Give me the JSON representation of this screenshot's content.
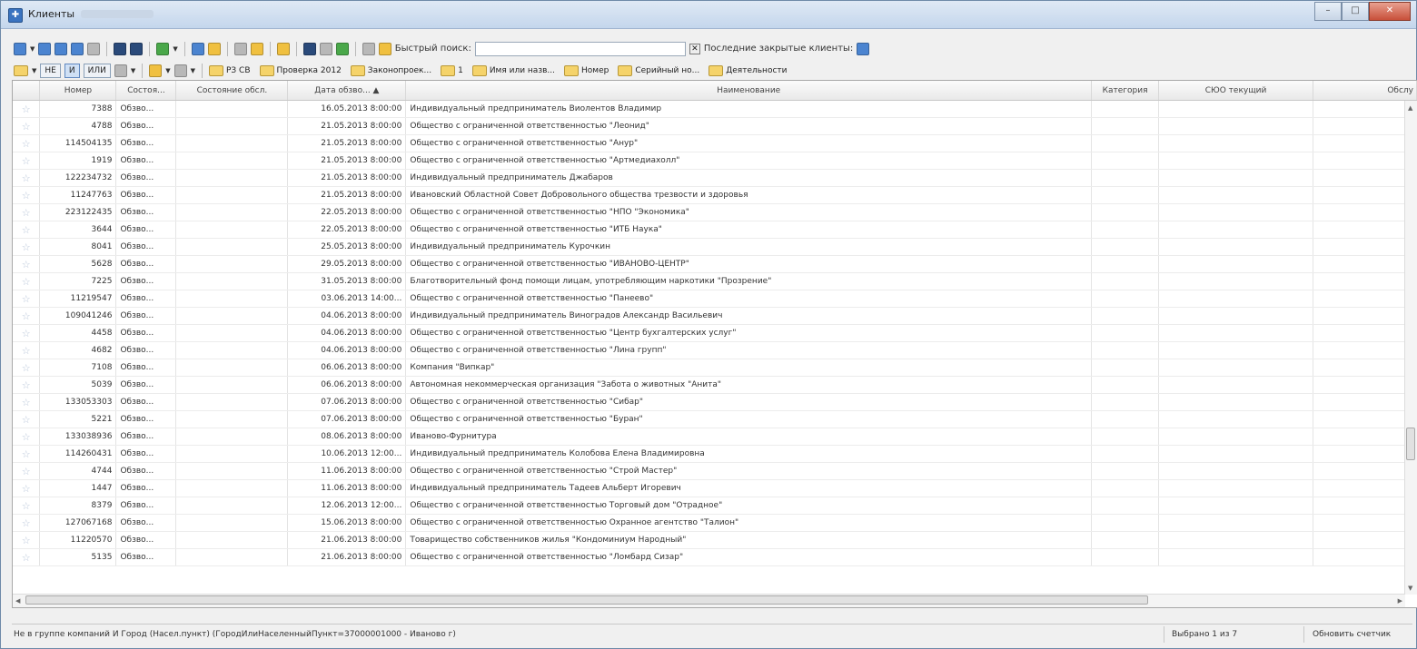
{
  "window": {
    "title": "Клиенты",
    "buttons": [
      "minimize",
      "maximize",
      "close"
    ]
  },
  "toolbar1": {
    "quick_search_label": "Быстрый поиск:",
    "quick_search_value": "",
    "recent_label": "Последние закрытые клиенты:"
  },
  "toolbar2": {
    "bool_not": "НЕ",
    "bool_and": "И",
    "bool_or": "ИЛИ",
    "filters": [
      "РЗ СВ",
      "Проверка 2012",
      "Законопроек...",
      "1",
      "Имя или назв...",
      "Номер",
      "Серийный но...",
      "Деятельности"
    ]
  },
  "grid": {
    "columns": [
      "",
      "Номер",
      "Состоя...",
      "Состояние обсл.",
      "Дата обзво... ▲",
      "Наименование",
      "Категория",
      "СЮО текущий",
      "Обслу"
    ],
    "rows": [
      [
        "7388",
        "Обзво...",
        "",
        "16.05.2013 8:00:00",
        "Индивидуальный предприниматель Виолентов Владимир"
      ],
      [
        "4788",
        "Обзво...",
        "",
        "21.05.2013 8:00:00",
        "Общество с ограниченной ответственностью \"Леонид\""
      ],
      [
        "114504135",
        "Обзво...",
        "",
        "21.05.2013 8:00:00",
        "Общество с ограниченной ответственностью \"Анур\""
      ],
      [
        "1919",
        "Обзво...",
        "",
        "21.05.2013 8:00:00",
        "Общество с ограниченной ответственностью \"Артмедиахолл\""
      ],
      [
        "122234732",
        "Обзво...",
        "",
        "21.05.2013 8:00:00",
        "Индивидуальный предприниматель Джабаров"
      ],
      [
        "11247763",
        "Обзво...",
        "",
        "21.05.2013 8:00:00",
        "Ивановский Областной Совет Добровольного общества трезвости и здоровья"
      ],
      [
        "223122435",
        "Обзво...",
        "",
        "22.05.2013 8:00:00",
        "Общество с ограниченной ответственностью \"НПО \"Экономика\""
      ],
      [
        "3644",
        "Обзво...",
        "",
        "22.05.2013 8:00:00",
        "Общество с ограниченной ответственностью \"ИТБ Наука\""
      ],
      [
        "8041",
        "Обзво...",
        "",
        "25.05.2013 8:00:00",
        "Индивидуальный предприниматель Курочкин"
      ],
      [
        "5628",
        "Обзво...",
        "",
        "29.05.2013 8:00:00",
        "Общество с ограниченной ответственностью \"ИВАНОВО-ЦЕНТР\""
      ],
      [
        "7225",
        "Обзво...",
        "",
        "31.05.2013 8:00:00",
        "Благотворительный фонд помощи лицам, употребляющим наркотики \"Прозрение\""
      ],
      [
        "11219547",
        "Обзво...",
        "",
        "03.06.2013 14:00...",
        "Общество с ограниченной ответственностью \"Панеево\""
      ],
      [
        "109041246",
        "Обзво...",
        "",
        "04.06.2013 8:00:00",
        "Индивидуальный предприниматель Виноградов Александр Васильевич"
      ],
      [
        "4458",
        "Обзво...",
        "",
        "04.06.2013 8:00:00",
        "Общество с ограниченной ответственностью \"Центр бухгалтерских услуг\""
      ],
      [
        "4682",
        "Обзво...",
        "",
        "04.06.2013 8:00:00",
        "Общество с ограниченной ответственностью \"Лина групп\""
      ],
      [
        "7108",
        "Обзво...",
        "",
        "06.06.2013 8:00:00",
        "Компания \"Випкар\""
      ],
      [
        "5039",
        "Обзво...",
        "",
        "06.06.2013 8:00:00",
        "Автономная некоммерческая организация \"Забота о животных \"Анита\""
      ],
      [
        "133053303",
        "Обзво...",
        "",
        "07.06.2013 8:00:00",
        "Общество с ограниченной ответственностью \"Сибар\""
      ],
      [
        "5221",
        "Обзво...",
        "",
        "07.06.2013 8:00:00",
        "Общество с ограниченной ответственностью \"Буран\""
      ],
      [
        "133038936",
        "Обзво...",
        "",
        "08.06.2013 8:00:00",
        "Иваново-Фурнитура"
      ],
      [
        "114260431",
        "Обзво...",
        "",
        "10.06.2013 12:00...",
        "Индивидуальный предприниматель Колобова Елена Владимировна"
      ],
      [
        "4744",
        "Обзво...",
        "",
        "11.06.2013 8:00:00",
        "Общество с ограниченной ответственностью \"Строй Мастер\""
      ],
      [
        "1447",
        "Обзво...",
        "",
        "11.06.2013 8:00:00",
        "Индивидуальный предприниматель Тадеев Альберт Игоревич"
      ],
      [
        "8379",
        "Обзво...",
        "",
        "12.06.2013 12:00...",
        "Общество с ограниченной ответственностью Торговый дом \"Отрадное\""
      ],
      [
        "127067168",
        "Обзво...",
        "",
        "15.06.2013 8:00:00",
        "Общество с ограниченной ответственностью Охранное агентство \"Талион\""
      ],
      [
        "11220570",
        "Обзво...",
        "",
        "21.06.2013 8:00:00",
        "Товарищество собственников жилья \"Кондоминиум Народный\""
      ],
      [
        "5135",
        "Обзво...",
        "",
        "21.06.2013 8:00:00",
        "Общество с ограниченной ответственностью \"Ломбард Сизар\""
      ]
    ]
  },
  "statusbar": {
    "filter_text": "Не в группе компаний И Город (Насел.пункт) (ГородИлиНаселенныйПункт=37000001000 - Иваново г)",
    "selection": "Выбрано 1 из 7",
    "refresh": "Обновить счетчик"
  }
}
